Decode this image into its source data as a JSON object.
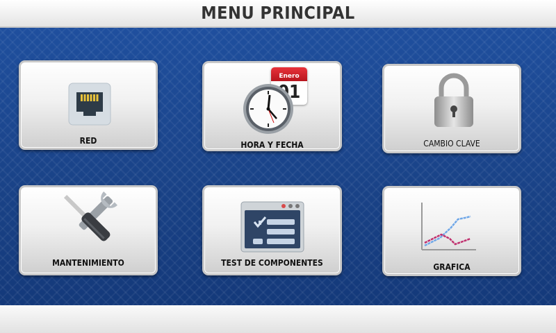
{
  "header": {
    "title": "MENU PRINCIPAL"
  },
  "menu": {
    "red": {
      "label": "RED",
      "icon": "ethernet-port-icon"
    },
    "hora_fecha": {
      "label": "HORA Y FECHA",
      "icon": "clock-calendar-icon",
      "calendar_month": "Enero",
      "calendar_day": "01"
    },
    "cambio_clave": {
      "label": "CAMBIO CLAVE",
      "icon": "padlock-icon"
    },
    "mantenimiento": {
      "label": "MANTENIMIENTO",
      "icon": "wrench-screwdriver-icon"
    },
    "test_componentes": {
      "label": "TEST DE COMPONENTES",
      "icon": "checklist-window-icon"
    },
    "grafica": {
      "label": "GRAFICA",
      "icon": "line-chart-icon"
    }
  },
  "colors": {
    "background": "#1d4a95",
    "header": "#ffffff",
    "label": "#111111"
  }
}
